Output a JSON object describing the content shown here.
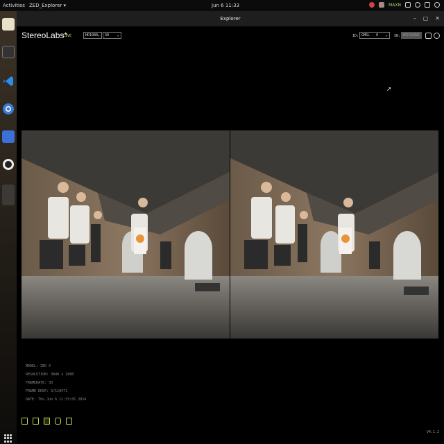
{
  "system_bar": {
    "activities": "Activities",
    "app_menu": "ZED_Explorer ▾",
    "clock": "Jun 6  11:33",
    "power_mode": "MAXN"
  },
  "window": {
    "title": "Explorer"
  },
  "app": {
    "brand": "StereoLabs*",
    "live_label": "LIVE",
    "resolution_select": "HD1080",
    "fps_select": "30",
    "id_label": "ID:",
    "id_select": "GMSL - 0",
    "sn_label": "SN:",
    "sn_value": "40726868"
  },
  "camera_info": [
    "MODEL: ZED X",
    "RESOLUTION: 3840 x 1080",
    "FRAMERATE: 30",
    "FRAME DROP: 3/110471",
    "DATE: Thu Jun 6 11:33:01 2024"
  ],
  "version": "V4.1.2",
  "colors": {
    "accent": "#c8d94f",
    "background": "#000000",
    "titlebar": "#1e1e1e"
  },
  "icons": {
    "footer": [
      "folder-icon",
      "record-icon",
      "video-mode-icon",
      "hdr-icon",
      "snapshot-icon"
    ],
    "header_right": [
      "settings-icon",
      "info-icon"
    ]
  }
}
